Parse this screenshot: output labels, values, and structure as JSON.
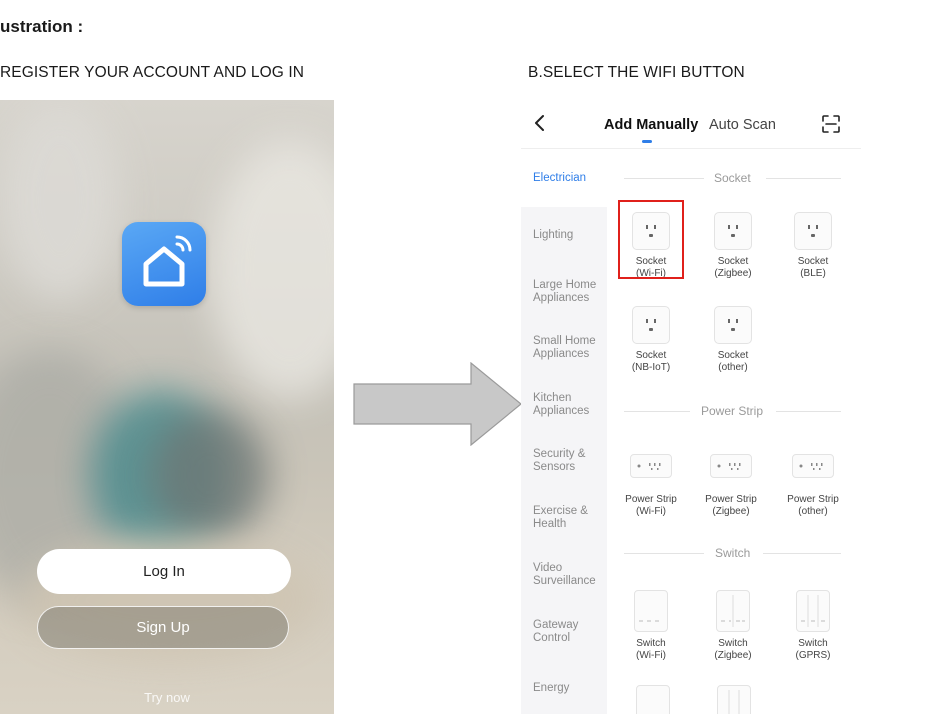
{
  "heading": "ustration :",
  "captions": {
    "a": "REGISTER YOUR ACCOUNT AND LOG IN",
    "b": "B.SELECT THE WIFI BUTTON"
  },
  "left_phone": {
    "login_label": "Log In",
    "signup_label": "Sign Up",
    "try_now_label": "Try now",
    "app_icon": "smart-home-house-wifi-icon"
  },
  "right_phone": {
    "tabs": {
      "manual": "Add Manually",
      "scan": "Auto Scan"
    },
    "icons": {
      "back": "chevron-left-icon",
      "scan": "scan-frame-icon"
    },
    "accent_color": "#2f7ee8",
    "highlight_color": "#e0201b",
    "sidebar": [
      "Electrician",
      "Lighting",
      "Large Home Appliances",
      "Small Home Appliances",
      "Kitchen Appliances",
      "Security & Sensors",
      "Exercise & Health",
      "Video Surveillance",
      "Gateway Control",
      "Energy"
    ],
    "sections": {
      "socket": "Socket",
      "power_strip": "Power Strip",
      "switch": "Switch"
    },
    "devices": {
      "socket_wifi": [
        "Socket",
        "(Wi-Fi)"
      ],
      "socket_zigbee": [
        "Socket",
        "(Zigbee)"
      ],
      "socket_ble": [
        "Socket",
        "(BLE)"
      ],
      "socket_nbiot": [
        "Socket",
        "(NB-IoT)"
      ],
      "socket_other": [
        "Socket",
        "(other)"
      ],
      "strip_wifi": [
        "Power Strip",
        "(Wi-Fi)"
      ],
      "strip_zigbee": [
        "Power Strip",
        "(Zigbee)"
      ],
      "strip_other": [
        "Power Strip",
        "(other)"
      ],
      "switch_wifi": [
        "Switch",
        "(Wi-Fi)"
      ],
      "switch_zigbee": [
        "Switch",
        "(Zigbee)"
      ],
      "switch_gprs": [
        "Switch",
        "(GPRS)"
      ]
    }
  }
}
